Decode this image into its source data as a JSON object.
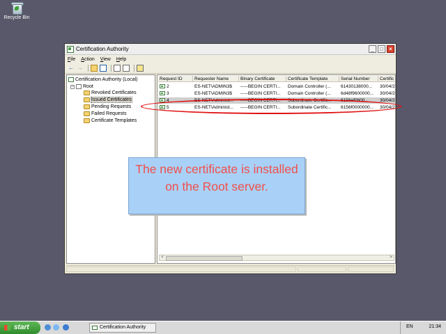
{
  "desktop": {
    "recycle_bin_label": "Recycle Bin"
  },
  "window": {
    "title": "Certification Authority",
    "controls": {
      "minimize": "_",
      "maximize": "□",
      "close": "×"
    }
  },
  "menu": {
    "items": [
      "File",
      "Action",
      "View",
      "Help"
    ]
  },
  "toolbar": {
    "icons": [
      "back-arrow-icon",
      "forward-arrow-icon",
      "up-folder-icon",
      "show-tree-icon",
      "refresh-icon",
      "export-list-icon",
      "help-icon"
    ],
    "back": "←",
    "forward": "→"
  },
  "tree": {
    "root_label": "Certification Authority (Local)",
    "ca_label": "Root",
    "ca_expander": "−",
    "folders": [
      "Revoked Certificates",
      "Issued Certificates",
      "Pending Requests",
      "Failed Requests",
      "Certificate Templates"
    ],
    "selected_folder": "Issued Certificates"
  },
  "table": {
    "columns": [
      "Request ID",
      "Requester Name",
      "Binary Certificate",
      "Certificate Template",
      "Serial Number",
      "Certific"
    ],
    "rows": [
      [
        "2",
        "ES-NET\\ADMIN3$",
        "-----BEGIN CERTI...",
        "Domain Controller (...",
        "61430138000...",
        "30/04/2"
      ],
      [
        "3",
        "ES-NET\\ADMIN3$",
        "-----BEGIN CERTI...",
        "Domain Controller (...",
        "6d48f9600000...",
        "30/04/2"
      ],
      [
        "4",
        "ES-NET\\Administ...",
        "-----BEGIN CERTI...",
        "Subordinate Certific...",
        "6156ef0600...",
        "30/04/2"
      ],
      [
        "5",
        "ES-NET\\Administ...",
        "-----BEGIN CERTI...",
        "Subordinate Certific...",
        "6156f0000000...",
        "30/04/2"
      ]
    ],
    "selected_row": "4",
    "scroll_left": "<",
    "scroll_right": ">"
  },
  "callout": {
    "text": "The new certificate is installed on the Root server."
  },
  "colors": {
    "callout_bg": "#a9d1f7",
    "callout_text": "#f14f4a",
    "highlight": "#e01010",
    "desktop": "#58586a"
  },
  "taskbar": {
    "start_label": "start",
    "task_label": "Certification Authority",
    "language": "EN",
    "clock": "21:34"
  }
}
